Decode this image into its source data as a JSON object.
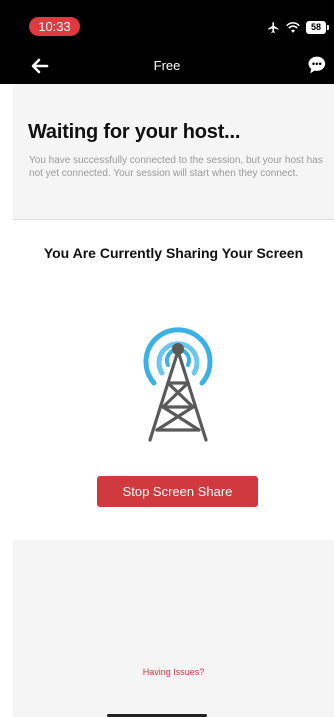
{
  "status_bar": {
    "time": "10:33",
    "battery": "58",
    "icons": [
      "airplane-icon",
      "wifi-icon",
      "battery-icon"
    ]
  },
  "nav": {
    "title": "Free",
    "back_icon": "arrow-left-icon",
    "chat_icon": "chat-bubble-icon"
  },
  "waiting": {
    "title": "Waiting for your host...",
    "description": "You have successfully connected to the session, but your host has not yet connected. Your session will start when they connect."
  },
  "sharing": {
    "title": "You Are Currently Sharing Your Screen",
    "icon": "broadcast-tower-icon"
  },
  "actions": {
    "stop_label": "Stop Screen Share"
  },
  "footer": {
    "issues_label": "Having Issues?"
  },
  "colors": {
    "accent": "#d0393e",
    "signal": "#3ab0e4",
    "tower": "#5a5a5a",
    "panel": "#f5f5f5"
  }
}
